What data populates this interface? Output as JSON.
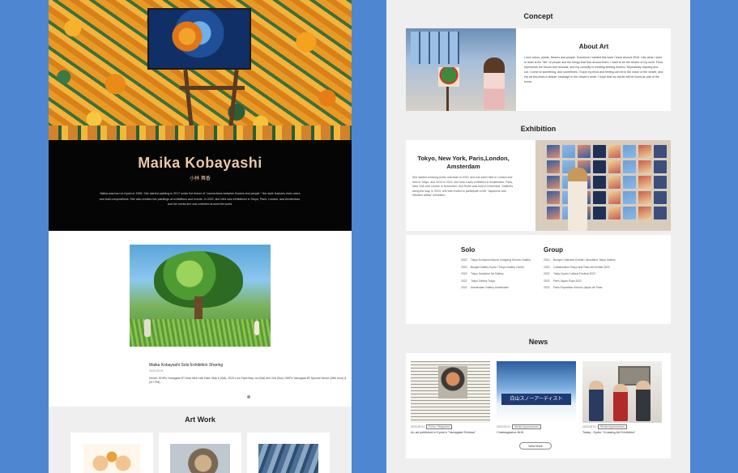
{
  "left": {
    "artist_name": "Maika Kobayashi",
    "artist_name_ja": "小林 舞香",
    "bio": "Maika was born in Kyoto in 1996. She started painting in 2017 under the theme of “connections between flowers and people.” Her style features vivid colors and bold compositions. She also creates live paintings at exhibitions and events. In 2022, she held solo exhibitions in Tokyo, Paris, London, and Amsterdam, and her works are now collected around the world.",
    "news_caption": {
      "title": "Maika Kobayashi Solo Exhibition Sharing",
      "date": "2023.05.01",
      "venue": "Venue: SHIPs Yamagata 2F Dear Nice Hall Date: May 6 (Sat), 2023 Live Paint May 1st (Sat) and 2nd (Sun) SHIPs Yamagata 8F Special Venue (26th floor) & (3/7 PM)"
    },
    "artwork_title": "Art Work"
  },
  "right": {
    "concept_title": "Concept",
    "about_title": "About Art",
    "about_text": "I love colors, plants, flowers and people. Somehow I started this work I have around 2018. Like what I want to draw is the \"life\" of people and the things that flow around them. I want to be the bearer of my work. Flora represents the bloom and renewal, and my curiosity is creating fleeting flowers. Repeatedly drawing and cut, I come to something, and sometimes, I hope my mind and feeling can be in the reach of the viewer, and my art becomes a deeper message in the viewer's heart. I hope that my works will be loved as part of the home.",
    "exhibition_title": "Exhibition",
    "exhibition_heading": "Tokyo, New York, Paris,London, Amsterdam",
    "exhibition_text": "She started showing works overseas in 2019, and has been held in London and held in Tokyo, and 2019 to 2022, she held a solo exhibition in Amsterdam, Paris, New York and London in November, and Rome was held in December. Galleries along the way. In 2023, she was invited to participate in the \"Japanese and Western artists\" exhibition.",
    "solo_title": "Solo",
    "group_title": "Group",
    "solo_items": [
      {
        "year": "2022",
        "event": "Tokyo Kuniyoshi Airport shopping Kimono Gallery"
      },
      {
        "year": "2022",
        "event": "Bungei Gallery Kyoto / Tokyo Gallery Center"
      },
      {
        "year": "2022",
        "event": "Tokyo Sunshine Art Gallery"
      },
      {
        "year": "2022",
        "event": "Tokyo Gallery Tokyo"
      },
      {
        "year": "2022",
        "event": "Amsterdam Gallery Amsterdam"
      }
    ],
    "group_items": [
      {
        "year": "2022",
        "event": "Bungei Collective Exhibit / Abouttime Tokyo Gallery"
      },
      {
        "year": "2022",
        "event": "Collaboration Tokyo and Paris Art Exhibit 2022"
      },
      {
        "year": "2022",
        "event": "Tokyo Kyoto Cultural Festival 2022"
      },
      {
        "year": "2022",
        "event": "Paris Japan Expo 2022"
      },
      {
        "year": "2022",
        "event": "Paris Exposition Kimono Japan de Paris"
      }
    ],
    "news_title": "News",
    "news_items": [
      {
        "date": "2023.05.01",
        "tag": "Press / Magazine",
        "title": "An ad published in Kyoto's \"Yamagata Shinbun\""
      },
      {
        "date": "2023.05.01",
        "tag": "Media Appearances",
        "title": "Chatmagazine NHK"
      },
      {
        "date": "2023.05.01",
        "tag": "Media Appearances",
        "title": "Today - Kyoto \"Crossing Art Exhibition\""
      }
    ],
    "news_photo_banner": "白山スノーアーティスト",
    "view_more_label": "View More"
  }
}
